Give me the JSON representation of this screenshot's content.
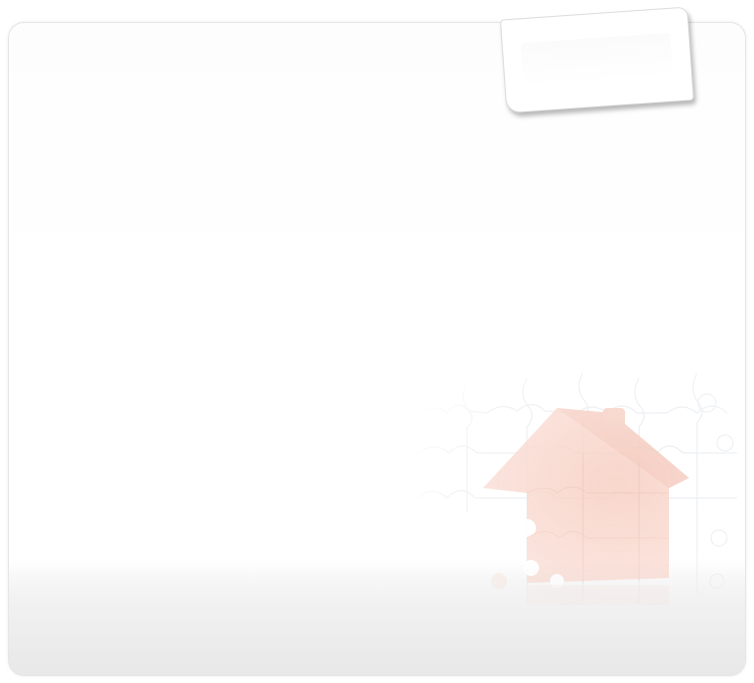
{
  "panel": {
    "background_color": "#ffffff",
    "border_color": "#e6e6e6",
    "floor_color": "#ececec"
  },
  "illustration": {
    "icon": "puzzle-house-icon",
    "house_color": "#f6c9bb",
    "puzzle_line_color": "#e4e8ee"
  },
  "note_card": {
    "icon": "blank-note-card",
    "color": "#ffffff",
    "shadow_color": "#b8b8b8"
  }
}
